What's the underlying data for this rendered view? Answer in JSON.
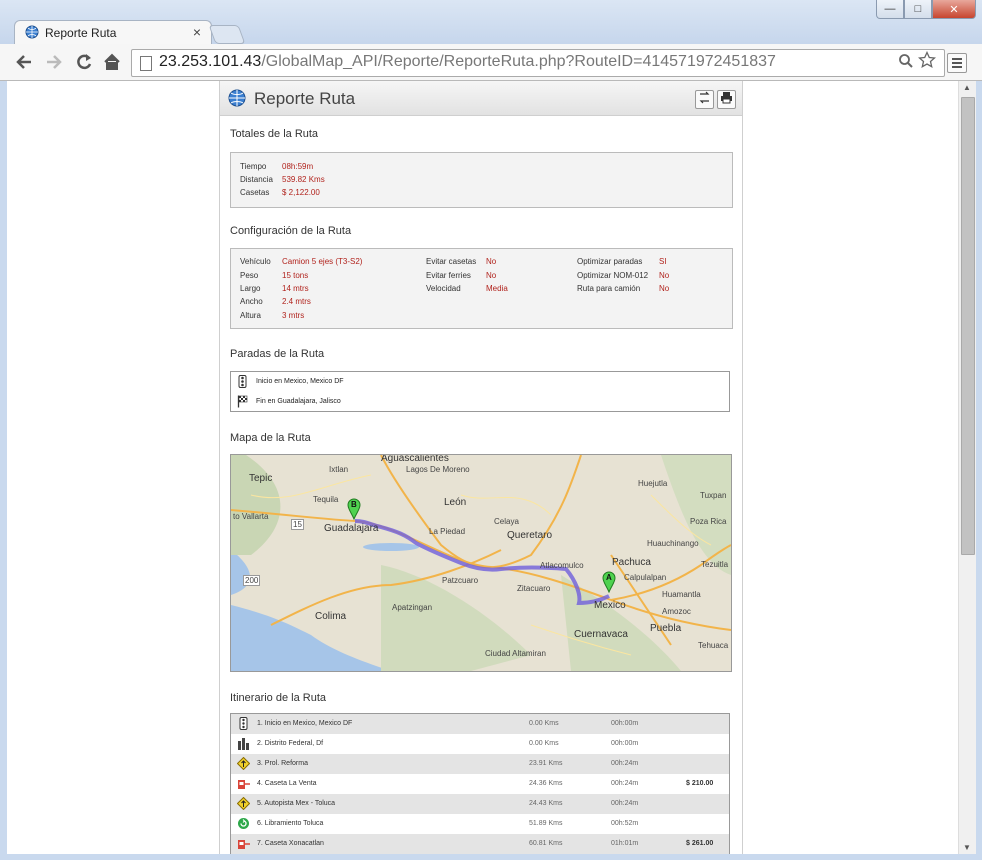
{
  "browser": {
    "tab_title": "Reporte Ruta",
    "tab_close": "×",
    "url_host": "23.253.101.43",
    "url_path": "/GlobalMap_API/Reporte/ReporteRuta.php?RouteID=414571972451837",
    "window_min": "—",
    "window_max": "□",
    "window_close": "✕"
  },
  "header": {
    "title": "Reporte Ruta"
  },
  "totales": {
    "title": "Totales de la Ruta",
    "rows": [
      {
        "label": "Tiempo",
        "value": "08h:59m"
      },
      {
        "label": "Distancia",
        "value": "539.82 Kms"
      },
      {
        "label": "Casetas",
        "value": "$ 2,122.00"
      }
    ]
  },
  "config": {
    "title": "Configuración de la Ruta",
    "col1": [
      {
        "label": "Vehículo",
        "value": "Camion 5 ejes (T3-S2)"
      },
      {
        "label": "Peso",
        "value": "15 tons"
      },
      {
        "label": "Largo",
        "value": "14 mtrs"
      },
      {
        "label": "Ancho",
        "value": "2.4 mtrs"
      },
      {
        "label": "Altura",
        "value": "3 mtrs"
      }
    ],
    "col2": [
      {
        "label": "Evitar casetas",
        "value": "No"
      },
      {
        "label": "Evitar ferries",
        "value": "No"
      },
      {
        "label": "Velocidad",
        "value": "Media"
      }
    ],
    "col3": [
      {
        "label": "Optimizar paradas",
        "value": "SI"
      },
      {
        "label": "Optimizar NOM-012",
        "value": "No"
      },
      {
        "label": "Ruta para camión",
        "value": "No"
      }
    ]
  },
  "paradas": {
    "title": "Paradas de la Ruta",
    "items": [
      {
        "icon": "traffic-light-icon",
        "text": "Inicio en Mexico, Mexico DF"
      },
      {
        "icon": "checkered-flag-icon",
        "text": "Fin en Guadalajara, Jalisco"
      }
    ]
  },
  "mapa": {
    "title": "Mapa de la Ruta",
    "marker_a": "A",
    "marker_b": "B",
    "labels": {
      "aguascalientes": "Aguascalientes",
      "lagos": "Lagos De Moreno",
      "tepic": "Tepic",
      "leon": "León",
      "tequila": "Tequila",
      "guadalajara": "Guadalajara",
      "vallarta": "to Vallarta",
      "lapiedad": "La Piedad",
      "celaya": "Celaya",
      "queretaro": "Queretaro",
      "patzcuaro": "Patzcuaro",
      "atlacomulco": "Atlacomulco",
      "zitacuaro": "Zitacuaro",
      "colima": "Colima",
      "apatzingan": "Apatzingan",
      "mexico": "Mexico",
      "cuernavaca": "Cuernavaca",
      "puebla": "Puebla",
      "pachuca": "Pachuca",
      "calpulalpan": "Calpulalpan",
      "huejutla": "Huejutla",
      "tuxpan": "Tuxpan",
      "pozarica": "Poza Rica",
      "huauchinango": "Huauchinango",
      "tezuitla": "Tezuitla",
      "huamantla": "Huamantla",
      "amozoc": "Amozoc",
      "tehuacan": "Tehuaca",
      "ciudadaltamirano": "Ciudad Altamiran",
      "ixtlan": "Ixtlan",
      "route200": "200",
      "route15": "15"
    }
  },
  "itinerario": {
    "title": "Itinerario de la Ruta",
    "rows": [
      {
        "icon": "traffic-light-icon",
        "desc": "1.  Inicio en Mexico, Mexico DF",
        "km": "0.00 Kms",
        "time": "00h:00m",
        "cost": ""
      },
      {
        "icon": "city-icon",
        "desc": "2.  Distrito Federal, Df",
        "km": "0.00 Kms",
        "time": "00h:00m",
        "cost": ""
      },
      {
        "icon": "straight-arrow-icon",
        "desc": "3.  Prol. Reforma",
        "km": "23.91 Kms",
        "time": "00h:24m",
        "cost": ""
      },
      {
        "icon": "toll-booth-icon",
        "desc": "4.  Caseta La Venta",
        "km": "24.36 Kms",
        "time": "00h:24m",
        "cost": "$ 210.00"
      },
      {
        "icon": "straight-arrow-icon",
        "desc": "5.  Autopista Mex - Toluca",
        "km": "24.43 Kms",
        "time": "00h:24m",
        "cost": ""
      },
      {
        "icon": "roundabout-icon",
        "desc": "6.  Libramiento Toluca",
        "km": "51.89 Kms",
        "time": "00h:52m",
        "cost": ""
      },
      {
        "icon": "toll-booth-icon",
        "desc": "7.  Caseta Xonacatlan",
        "km": "60.81 Kms",
        "time": "01h:01m",
        "cost": "$ 261.00"
      }
    ]
  }
}
